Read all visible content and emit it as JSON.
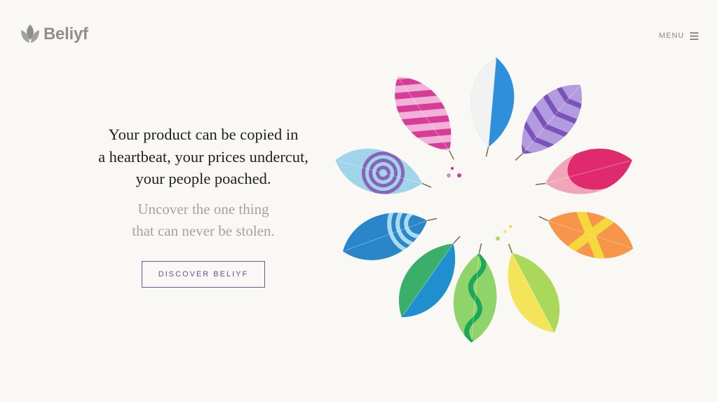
{
  "brand": {
    "name": "Beliyf"
  },
  "nav": {
    "menu_label": "MENU"
  },
  "hero": {
    "headline_lines": [
      "Your product can be copied in",
      "a heartbeat, your prices undercut,",
      "your people poached."
    ],
    "subhead_lines": [
      "Uncover the one thing",
      "that can never be stolen."
    ],
    "cta_label": "DISCOVER BELIYF"
  },
  "colors": {
    "background": "#faf8f5",
    "text": "#1f1f1f",
    "muted_text": "#a3a3a3",
    "accent": "#7a4fa0",
    "logo": "#8f8f8f"
  },
  "icons": [
    "logo-leaf-icon",
    "hamburger-menu-icon"
  ],
  "illustration": {
    "leaves": [
      {
        "name": "blue-white-leaf",
        "color_a": "#2f8fdc",
        "color_b": "#f2f2f2",
        "pattern": "split"
      },
      {
        "name": "purple-chevron-leaf",
        "color_a": "#b39be0",
        "color_b": "#7b52b8",
        "pattern": "chevron"
      },
      {
        "name": "pink-red-leaf",
        "color_a": "#f0a6b8",
        "color_b": "#e02a6e",
        "pattern": "splash"
      },
      {
        "name": "orange-cross-leaf",
        "color_a": "#f7964a",
        "color_b": "#f5d83c",
        "pattern": "cross"
      },
      {
        "name": "yellow-green-leaf",
        "color_a": "#f4e45a",
        "color_b": "#a9d85a",
        "pattern": "split"
      },
      {
        "name": "green-wave-leaf",
        "color_a": "#8fd46a",
        "color_b": "#1ba85a",
        "pattern": "wave"
      },
      {
        "name": "green-blue-leaf",
        "color_a": "#3aaf6a",
        "color_b": "#1f8fd0",
        "pattern": "split"
      },
      {
        "name": "blue-arc-leaf",
        "color_a": "#2a86c8",
        "color_b": "#a8dcef",
        "pattern": "arcs"
      },
      {
        "name": "light-blue-spiral-leaf",
        "color_a": "#9fd4ea",
        "color_b": "#8a62b8",
        "pattern": "spiral"
      },
      {
        "name": "pink-stripe-leaf",
        "color_a": "#f0b2d8",
        "color_b": "#d83c98",
        "pattern": "stripes"
      }
    ]
  }
}
